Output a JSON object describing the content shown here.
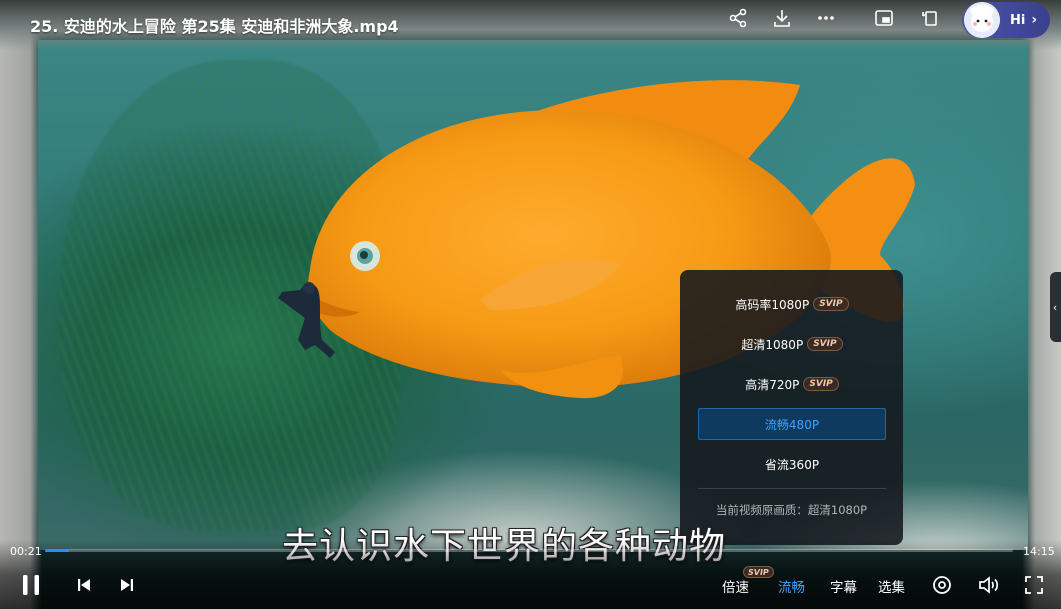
{
  "header": {
    "title": "25. 安迪的水上冒险 第25集 安迪和非洲大象.mp4",
    "hi_label": "Hi",
    "icons": [
      "share-icon",
      "download-icon",
      "more-icon",
      "picture-in-picture-icon",
      "rotate-icon"
    ]
  },
  "subtitle": "去认识水下世界的各种动物",
  "quality_menu": {
    "options": [
      {
        "label": "高码率1080P",
        "badge": "SVIP",
        "active": false
      },
      {
        "label": "超清1080P",
        "badge": "SVIP",
        "active": false
      },
      {
        "label": "高清720P",
        "badge": "SVIP",
        "active": false
      },
      {
        "label": "流畅480P",
        "badge": "",
        "active": true
      },
      {
        "label": "省流360P",
        "badge": "",
        "active": false
      }
    ],
    "original_quality": "当前视频原画质：超清1080P"
  },
  "playback": {
    "current_time": "00:21",
    "total_time": "14:15",
    "progress_percent": 2.5
  },
  "controls": {
    "speed_label": "倍速",
    "speed_badge": "SVIP",
    "quality_label": "流畅",
    "subtitle_label": "字幕",
    "episodes_label": "选集"
  },
  "colors": {
    "accent": "#3aa3ff",
    "progress": "#2f8cff",
    "svip": "#f1c9a6"
  }
}
